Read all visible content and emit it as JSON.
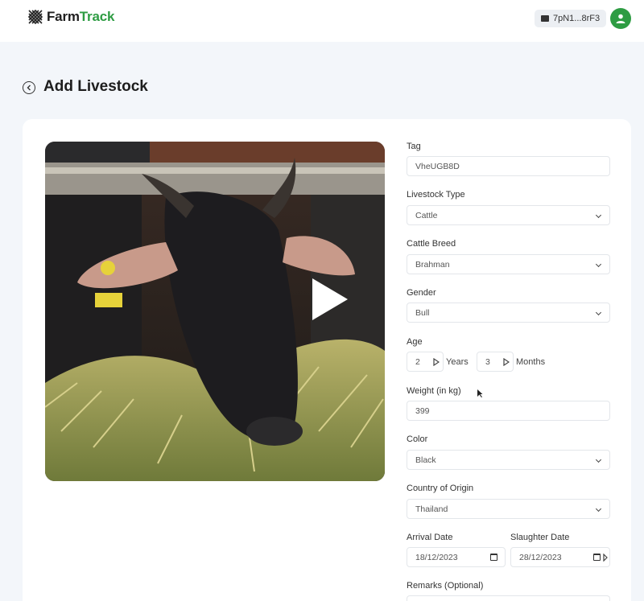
{
  "header": {
    "brand_part1": "Farm",
    "brand_part2": "Track",
    "wallet_address": "7pN1...8rF3",
    "brand_accent_color": "#2e9c43"
  },
  "page": {
    "title": "Add Livestock"
  },
  "media": {
    "description_icon": "play-icon"
  },
  "form": {
    "tag": {
      "label": "Tag",
      "value": "VheUGB8D"
    },
    "livestock_type": {
      "label": "Livestock Type",
      "value": "Cattle"
    },
    "breed": {
      "label": "Cattle Breed",
      "value": "Brahman"
    },
    "gender": {
      "label": "Gender",
      "value": "Bull"
    },
    "age": {
      "label": "Age",
      "years_value": "2",
      "years_label": "Years",
      "months_value": "3",
      "months_label": "Months"
    },
    "weight": {
      "label": "Weight (in kg)",
      "value": "399"
    },
    "color": {
      "label": "Color",
      "value": "Black"
    },
    "country": {
      "label": "Country of Origin",
      "value": "Thailand"
    },
    "arrival_date": {
      "label": "Arrival Date",
      "value": "18/12/2023"
    },
    "slaughter_date": {
      "label": "Slaughter Date",
      "value": "28/12/2023"
    },
    "remarks": {
      "label": "Remarks (Optional)"
    }
  }
}
